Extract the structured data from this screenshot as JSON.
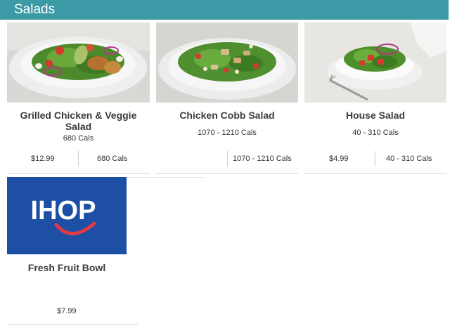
{
  "section": {
    "title": "Salads"
  },
  "items": [
    {
      "name": "Grilled Chicken & Veggie Salad",
      "cals": "680 Cals",
      "price": "$12.99",
      "price_cals": "680 Cals"
    },
    {
      "name": "Chicken Cobb Salad",
      "cals": "1070 - 1210 Cals",
      "price": "",
      "price_cals": "1070 - 1210 Cals"
    },
    {
      "name": "House Salad",
      "cals": "40 - 310 Cals",
      "price": "$4.99",
      "price_cals": "40 - 310 Cals"
    },
    {
      "name": "Fresh Fruit Bowl",
      "cals": "",
      "price": "$7.99",
      "price_cals": ""
    }
  ],
  "logo": {
    "text": "IHOP",
    "bg_color": "#1d4fa5",
    "smile_color": "#e03a45"
  }
}
